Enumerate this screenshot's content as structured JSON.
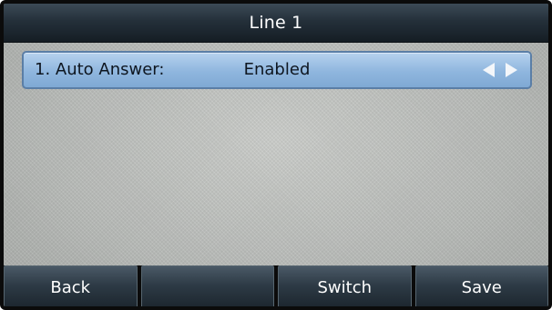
{
  "header": {
    "title": "Line 1"
  },
  "setting": {
    "label": "1. Auto Answer:",
    "value": "Enabled",
    "left_arrow_icon": "triangle-left-icon",
    "right_arrow_icon": "triangle-right-icon"
  },
  "softkeys": [
    {
      "label": "Back"
    },
    {
      "label": ""
    },
    {
      "label": "Switch"
    },
    {
      "label": "Save"
    }
  ],
  "colors": {
    "title_bar": "#24303a",
    "row_highlight": "#8fb6de",
    "softkey": "#2d3a45",
    "background": "#b9bcb9"
  }
}
